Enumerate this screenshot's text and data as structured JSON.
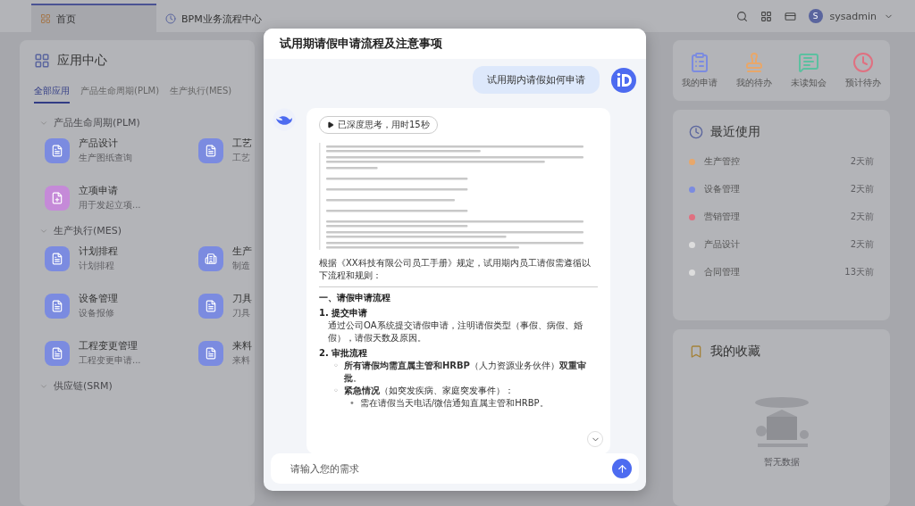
{
  "topbar": {
    "tabs": [
      {
        "label": "首页",
        "selected": true
      },
      {
        "label": "BPM业务流程中心",
        "selected": false
      }
    ],
    "user": {
      "initial": "S",
      "name": "sysadmin"
    }
  },
  "app_center": {
    "title": "应用中心",
    "tabs": [
      {
        "label": "全部应用",
        "selected": true
      },
      {
        "label": "产品生命周期(PLM)",
        "selected": false
      },
      {
        "label": "生产执行(MES)",
        "selected": false
      }
    ],
    "sections": [
      {
        "title": "产品生命周期(PLM)",
        "expanded": true,
        "apps": [
          {
            "name": "产品设计",
            "desc": "生产图纸查询",
            "kind": "doc",
            "color": "#7b8be0"
          },
          {
            "name": "工艺",
            "desc": "工艺",
            "kind": "doc",
            "color": "#7b8be0"
          },
          {
            "name": "立项申请",
            "desc": "用于发起立项...",
            "kind": "plus",
            "color": "#c58ad8"
          }
        ]
      },
      {
        "title": "生产执行(MES)",
        "expanded": true,
        "apps": [
          {
            "name": "计划排程",
            "desc": "计划排程",
            "kind": "doc",
            "color": "#7b8be0"
          },
          {
            "name": "生产",
            "desc": "制造",
            "kind": "building",
            "color": "#7b8be0"
          },
          {
            "name": "设备管理",
            "desc": "设备报修",
            "kind": "doc",
            "color": "#7b8be0"
          },
          {
            "name": "刀具",
            "desc": "刀具",
            "kind": "doc",
            "color": "#7b8be0"
          },
          {
            "name": "工程变更管理",
            "desc": "工程变更申请...",
            "kind": "doc",
            "color": "#7b8be0"
          },
          {
            "name": "来料",
            "desc": "来料",
            "kind": "doc",
            "color": "#7b8be0"
          }
        ]
      },
      {
        "title": "供应链(SRM)",
        "expanded": true
      }
    ]
  },
  "quick_actions": [
    {
      "label": "我的申请",
      "kind": "clipboard",
      "color": "#7b8be0"
    },
    {
      "label": "我的待办",
      "kind": "stamp",
      "color": "#e8a76a"
    },
    {
      "label": "未读知会",
      "kind": "message",
      "color": "#5cc0a0"
    },
    {
      "label": "预计待办",
      "kind": "clock",
      "color": "#e07080"
    }
  ],
  "recent": {
    "title": "最近使用",
    "items": [
      {
        "name": "生产管控",
        "time": "2天前",
        "color": "#e8a76a"
      },
      {
        "name": "设备管理",
        "time": "2天前",
        "color": "#7b8be0"
      },
      {
        "name": "营销管理",
        "time": "2天前",
        "color": "#e07080"
      },
      {
        "name": "产品设计",
        "time": "2天前",
        "color": "#dddddd"
      },
      {
        "name": "合同管理",
        "time": "13天前",
        "color": "#dddddd"
      }
    ]
  },
  "favorites": {
    "title": "我的收藏",
    "empty_text": "暂无数据"
  },
  "dialog": {
    "title": "试用期请假申请流程及注意事项",
    "question": "试用期内请假如何申请",
    "thinking_label": "已深度思考，用时15秒",
    "answer": [
      {
        "kind": "paragraph",
        "text": "根据《XX科技有限公司员工手册》规定，试用期内员工请假需遵循以下流程和规则："
      },
      {
        "kind": "divider"
      },
      {
        "kind": "heading",
        "text": "一、请假申请流程"
      },
      {
        "kind": "step",
        "number": "1.",
        "title": "提交申请",
        "text": "通过公司OA系统提交请假申请，注明请假类型（事假、病假、婚假），请假天数及原因。"
      },
      {
        "kind": "step",
        "number": "2.",
        "title": "审批流程",
        "bullets": [
          {
            "marker": "◦",
            "text": "**所有请假均需直属主管和HRBP**（人力资源业务伙伴）**双重审批**。"
          },
          {
            "marker": "◦",
            "text": "**紧急情况**（如突发疾病、家庭突发事件）：",
            "children": [
              {
                "marker": "•",
                "text": "需在请假当天电话/微信通知直属主管和HRBP。"
              }
            ]
          }
        ]
      }
    ],
    "input": {
      "placeholder": "请输入您的需求"
    }
  }
}
